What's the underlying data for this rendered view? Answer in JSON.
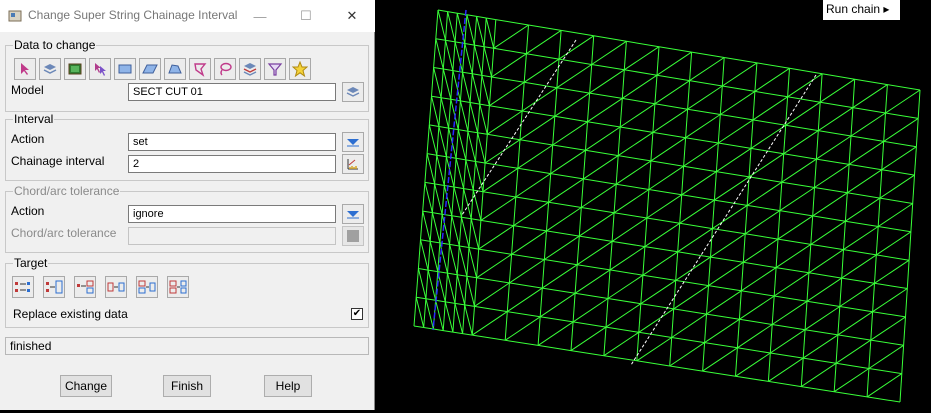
{
  "window": {
    "title": "Change Super String Chainage Interval",
    "minimize_icon": "minimize-icon",
    "maximize_icon": "maximize-icon",
    "close_icon": "close-icon"
  },
  "data_to_change": {
    "label": "Data to change",
    "tools": [
      "pointer-select-icon",
      "layers-icon",
      "image-icon",
      "pick-multi-icon",
      "rectangle-icon",
      "parallelogram-icon",
      "polygon-icon",
      "lasso-icon",
      "freehand-lasso-icon",
      "stack-icon",
      "filter-icon",
      "star-icon"
    ],
    "model_label": "Model",
    "model_value": "SECT CUT 01"
  },
  "interval": {
    "label": "Interval",
    "action_label": "Action",
    "action_value": "set",
    "chainage_label": "Chainage interval",
    "chainage_value": "2"
  },
  "chord": {
    "label": "Chord/arc tolerance",
    "action_label": "Action",
    "action_value": "ignore",
    "tolerance_label": "Chord/arc tolerance",
    "tolerance_value": ""
  },
  "target": {
    "label": "Target",
    "tools": [
      "target-option-1-icon",
      "target-option-2-icon",
      "target-option-3-icon",
      "target-option-4-icon",
      "target-option-5-icon",
      "target-option-6-icon"
    ],
    "replace_label": "Replace existing data",
    "replace_checked": true
  },
  "status": "finished",
  "buttons": {
    "change": "Change",
    "finish": "Finish",
    "help": "Help"
  },
  "viewport": {
    "run_chain_label": "Run chain",
    "mesh_color": "#39ff39",
    "line_color": "#ffffff",
    "blue_color": "#2a2aff"
  }
}
